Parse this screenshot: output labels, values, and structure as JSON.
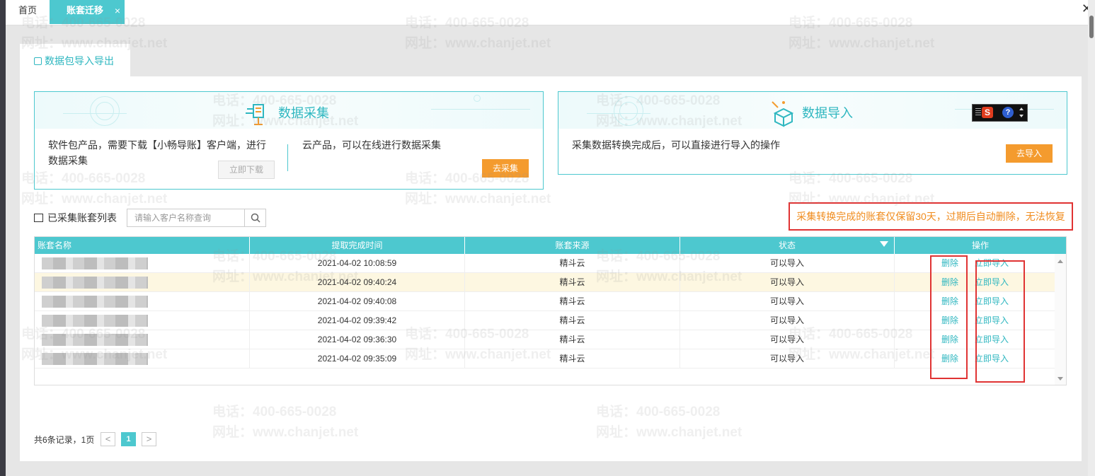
{
  "top_tabs": {
    "home": "首页",
    "active": "账套迁移",
    "close_glyph": "×"
  },
  "window": {
    "close_glyph": "✕"
  },
  "sub_tab": {
    "label": "数据包导入导出"
  },
  "collect_card": {
    "title": "数据采集",
    "software_text": "软件包产品，需要下载【小畅导账】客户端，进行数据采集",
    "download_button": "立即下载",
    "cloud_text": "云产品，可以在线进行数据采集",
    "collect_button": "去采集"
  },
  "import_card": {
    "title": "数据导入",
    "desc": "采集数据转换完成后，可以直接进行导入的操作",
    "import_button": "去导入"
  },
  "list": {
    "title": "已采集账套列表",
    "search_placeholder": "请输入客户名称查询",
    "notice": "采集转换完成的账套仅保留30天，过期后自动删除，无法恢复"
  },
  "table": {
    "columns": [
      "账套名称",
      "提取完成时间",
      "账套来源",
      "状态",
      "操作"
    ],
    "delete_label": "删除",
    "import_label": "立即导入",
    "rows": [
      {
        "time": "2021-04-02 10:08:59",
        "source": "精斗云",
        "status": "可以导入"
      },
      {
        "time": "2021-04-02 09:40:24",
        "source": "精斗云",
        "status": "可以导入"
      },
      {
        "time": "2021-04-02 09:40:08",
        "source": "精斗云",
        "status": "可以导入"
      },
      {
        "time": "2021-04-02 09:39:42",
        "source": "精斗云",
        "status": "可以导入"
      },
      {
        "time": "2021-04-02 09:36:30",
        "source": "精斗云",
        "status": "可以导入"
      },
      {
        "time": "2021-04-02 09:35:09",
        "source": "精斗云",
        "status": "可以导入"
      }
    ]
  },
  "pagination": {
    "summary": "共6条记录，1页",
    "prev": "<",
    "current": "1",
    "next": ">"
  },
  "watermark": {
    "phone": "电话：400-665-0028",
    "site": "网址：www.chanjet.net"
  },
  "colors": {
    "accent": "#4dc8cf",
    "orange": "#f49b2e",
    "alert_red": "#e03333",
    "highlight_row": "#fdf7e1"
  },
  "icons": [
    "search-icon",
    "filter-icon",
    "collect-icon",
    "import-icon",
    "document-icon",
    "box-icon",
    "close-icon"
  ]
}
